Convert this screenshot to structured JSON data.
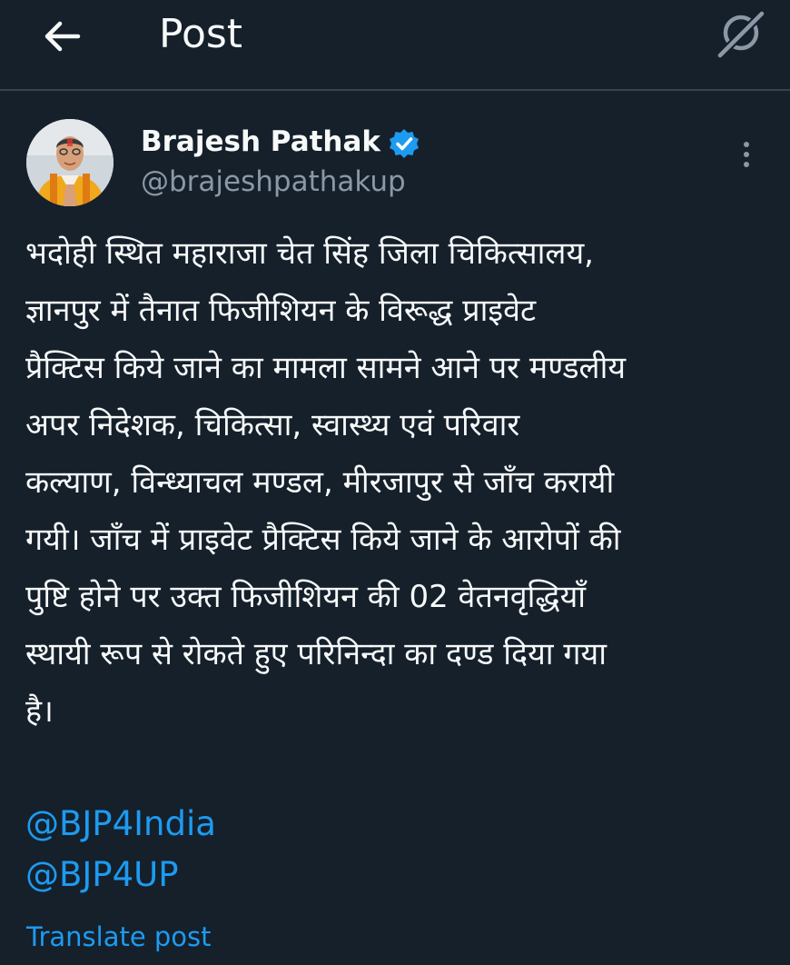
{
  "header": {
    "back_icon": "arrow-left-icon",
    "title": "Post",
    "grok_icon": "grok-icon"
  },
  "post": {
    "author": {
      "name": "Brajesh Pathak",
      "handle": "@brajeshpathakup",
      "verified_icon": "verified-badge-icon",
      "badge_color": "#1d9bf0"
    },
    "more_icon": "more-vertical-icon",
    "text_lines": [
      "भदोही स्थित महाराजा चेत सिंह जिला चिकित्सालय,",
      "ज्ञानपुर में तैनात फिजीशियन के विरूद्ध प्राइवेट",
      "प्रैक्टिस किये जाने का मामला सामने आने पर मण्डलीय",
      "अपर निदेशक, चिकित्सा, स्वास्थ्य एवं परिवार",
      "कल्याण, विन्ध्याचल मण्डल, मीरजापुर से जाँच करायी",
      "गयी। जाँच में प्राइवेट प्रैक्टिस किये जाने के आरोपों की",
      "पुष्टि होने पर उक्त फिजीशियन की 02 वेतनवृद्धियाँ",
      "स्थायी रूप से रोकते हुए परिनिन्दा का दण्ड दिया गया",
      "है।"
    ],
    "mentions": [
      "@BJP4India",
      "@BJP4UP"
    ],
    "translate_label": "Translate post"
  },
  "colors": {
    "background": "#15202b",
    "text": "#f7f9f9",
    "secondary_text": "#8b98a5",
    "link": "#1d9bf0",
    "divider": "#38444d"
  }
}
